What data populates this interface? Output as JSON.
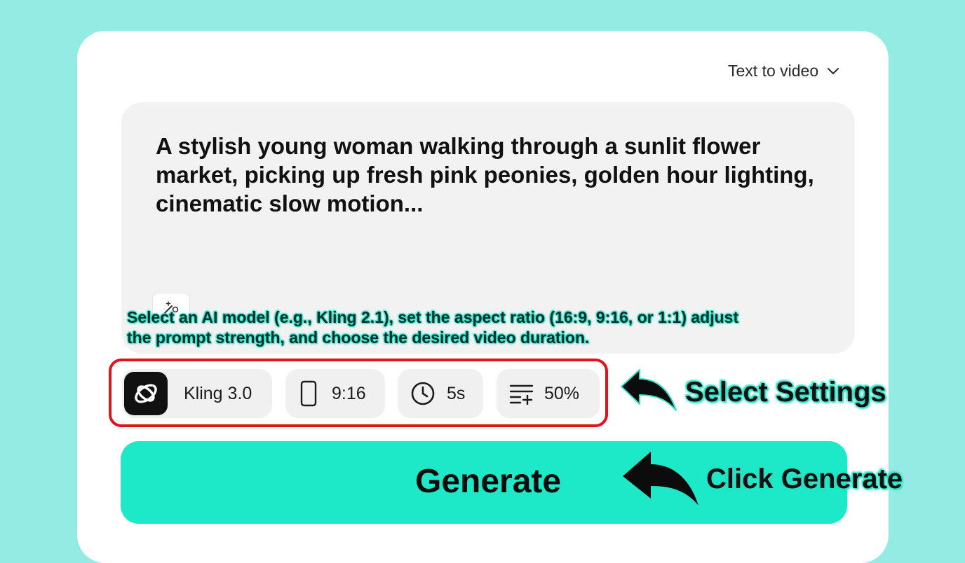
{
  "mode_selector": {
    "label": "Text to video",
    "icon": "chevron-down-icon"
  },
  "prompt": {
    "text": "A stylish young woman walking through a sunlit flower market, picking up fresh pink peonies, golden hour lighting, cinematic slow motion...",
    "enhance_icon": "magic-wand-icon"
  },
  "instruction_overlay": "Select an AI model (e.g., Kling 2.1), set the aspect ratio (16:9, 9:16, or 1:1) adjust the prompt strength, and choose the desired video duration.",
  "settings": {
    "model": {
      "label": "Kling 3.0",
      "icon": "kling-logo-icon"
    },
    "aspect_ratio": {
      "label": "9:16",
      "icon": "portrait-phone-icon"
    },
    "duration": {
      "label": "5s",
      "icon": "clock-icon"
    },
    "strength": {
      "label": "50%",
      "icon": "list-add-icon"
    }
  },
  "callouts": {
    "settings": "Select Settings",
    "generate": "Click Generate"
  },
  "generate_button": {
    "label": "Generate"
  },
  "colors": {
    "background": "#93ebe3",
    "accent": "#1de9c8",
    "highlight_border": "#e0141e"
  }
}
